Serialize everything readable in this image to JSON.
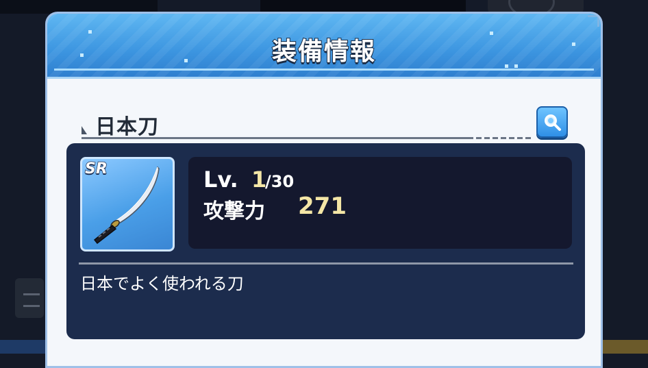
{
  "dialog": {
    "title": "装備情報"
  },
  "item": {
    "name": "日本刀",
    "rarity": "SR",
    "level_label": "Lv.",
    "level": "1",
    "level_max": "/30",
    "attack_label": "攻撃力",
    "attack": "271",
    "description": "日本でよく使われる刀"
  },
  "icons": {
    "search": "magnifier-icon",
    "item": "katana-icon"
  },
  "colors": {
    "header_blue": "#3c95e0",
    "panel_navy": "#1c2c4d",
    "stat_highlight": "#f4e6a6",
    "card_blue": "#4a9fe8"
  }
}
